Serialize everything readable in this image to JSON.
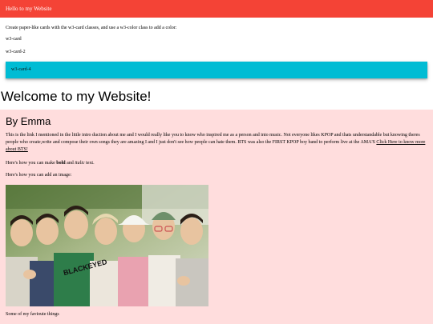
{
  "header": {
    "title": "Hello to my Website",
    "color": "#f44336"
  },
  "cards": {
    "intro": "Create paper-like cards with the w3-card classes, and use a w3-color class to add a color:",
    "card_label": "w3-card",
    "card2_label": "w3-card-2",
    "card4_label": "w3-card-4",
    "card4_color": "#00bcd4"
  },
  "main": {
    "heading": "Welcome to my Website!",
    "background": "#ffdddd",
    "byline": "By Emma",
    "paragraph": "This is the link I mentioned in the little intro duction about me and I would really like you to know who inspired me as a person and into music. Not everyone likes KPOP and thats understandable but knowing theres people who create,write and compose their own songs they are amazing I and I just don't see how people can hate them. BTS was also the FIRST KPOP boy band to perform live at the AMA'S",
    "link_text": "Click Here to know more about BTS!",
    "format_prefix": "Here's how you can make",
    "format_bold": "bold",
    "format_and": "and",
    "format_italic": "italic",
    "format_suffix": "text.",
    "image_line": "Here's how you can add an image:",
    "image_text": "BLACKEYED",
    "favorites_line": "Some of my favioute things"
  }
}
